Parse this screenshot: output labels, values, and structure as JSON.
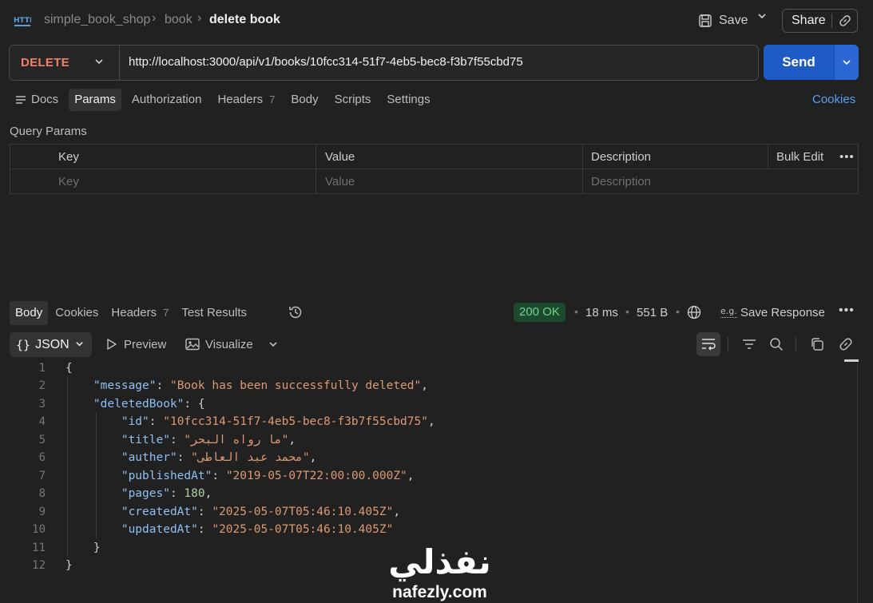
{
  "breadcrumb": {
    "collection": "simple_book_shop",
    "folder": "book",
    "request": "delete book",
    "icon_label": "HTTP"
  },
  "header": {
    "save_label": "Save",
    "share_label": "Share"
  },
  "request": {
    "method": "DELETE",
    "url": "http://localhost:3000/api/v1/books/10fcc314-51f7-4eb5-bec8-f3b7f55cbd75",
    "send_label": "Send"
  },
  "request_tabs": {
    "docs": "Docs",
    "params": "Params",
    "authorization": "Authorization",
    "headers": "Headers",
    "headers_count": "7",
    "body": "Body",
    "scripts": "Scripts",
    "settings": "Settings",
    "cookies": "Cookies"
  },
  "query_params": {
    "title": "Query Params",
    "columns": {
      "key": "Key",
      "value": "Value",
      "description": "Description",
      "bulk_edit": "Bulk Edit"
    },
    "placeholders": {
      "key": "Key",
      "value": "Value",
      "description": "Description"
    }
  },
  "response_tabs": {
    "body": "Body",
    "cookies": "Cookies",
    "headers": "Headers",
    "headers_count": "7",
    "test_results": "Test Results"
  },
  "response_meta": {
    "status": "200 OK",
    "time": "18 ms",
    "size": "551 B",
    "save_response": "Save Response",
    "eg_label": "e.g."
  },
  "format_bar": {
    "format": "JSON",
    "preview": "Preview",
    "visualize": "Visualize"
  },
  "code_lines": [
    {
      "n": "1",
      "t": "{"
    },
    {
      "n": "2",
      "t": "    \"message\": \"Book has been successfully deleted\","
    },
    {
      "n": "3",
      "t": "    \"deletedBook\": {"
    },
    {
      "n": "4",
      "t": "        \"id\": \"10fcc314-51f7-4eb5-bec8-f3b7f55cbd75\","
    },
    {
      "n": "5",
      "t": "        \"title\": \"ما رواه البحر\","
    },
    {
      "n": "6",
      "t": "        \"auther\": \"محمد عبد العاطى\","
    },
    {
      "n": "7",
      "t": "        \"publishedAt\": \"2019-05-07T22:00:00.000Z\","
    },
    {
      "n": "8",
      "t": "        \"pages\": 180,"
    },
    {
      "n": "9",
      "t": "        \"createdAt\": \"2025-05-07T05:46:10.405Z\","
    },
    {
      "n": "10",
      "t": "        \"updatedAt\": \"2025-05-07T05:46:10.405Z\""
    },
    {
      "n": "11",
      "t": "    }"
    },
    {
      "n": "12",
      "t": "}"
    }
  ],
  "watermark": {
    "arabic": "نفذلي",
    "latin": "nafezly.com"
  },
  "colors": {
    "accent": "#1f5bc4",
    "method": "#f0816b",
    "status_ok": "#6fd38f",
    "json_key": "#8fc0f2",
    "json_string": "#dd9a72",
    "json_number": "#b5cea8"
  }
}
